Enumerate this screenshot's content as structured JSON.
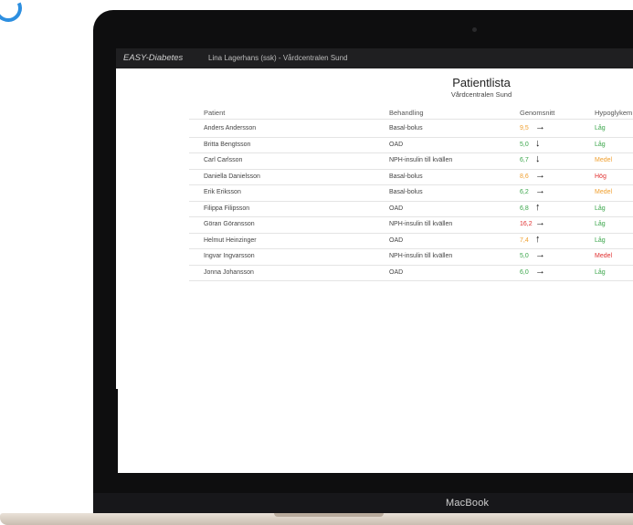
{
  "device": {
    "brand": "MacBook"
  },
  "app": {
    "title": "EASY-Diabetes",
    "user_info": "Lina Lagerhans (ssk) - Vårdcentralen Sund"
  },
  "page": {
    "title": "Patientlista",
    "subtitle": "Vårdcentralen Sund"
  },
  "table": {
    "headers": {
      "patient": "Patient",
      "treatment": "Behandling",
      "average": "Genomsnitt",
      "hypo": "Hypoglykem"
    },
    "rows": [
      {
        "patient": "Anders Andersson",
        "treatment": "Basal-bolus",
        "average": "9,5",
        "average_color": "#f0a030",
        "trend": "→",
        "hypo": "Låg",
        "hypo_color": "#3aa54a"
      },
      {
        "patient": "Britta Bengtsson",
        "treatment": "OAD",
        "average": "5,0",
        "average_color": "#3aa54a",
        "trend": "↓",
        "hypo": "Låg",
        "hypo_color": "#3aa54a"
      },
      {
        "patient": "Carl Carlsson",
        "treatment": "NPH-insulin till kvällen",
        "average": "6,7",
        "average_color": "#3aa54a",
        "trend": "↓",
        "hypo": "Medel",
        "hypo_color": "#f0a030"
      },
      {
        "patient": "Daniella Danielsson",
        "treatment": "Basal-bolus",
        "average": "8,6",
        "average_color": "#f0a030",
        "trend": "→",
        "hypo": "Hög",
        "hypo_color": "#e03030"
      },
      {
        "patient": "Erik Eriksson",
        "treatment": "Basal-bolus",
        "average": "6,2",
        "average_color": "#3aa54a",
        "trend": "→",
        "hypo": "Medel",
        "hypo_color": "#f0a030"
      },
      {
        "patient": "Filippa Filipsson",
        "treatment": "OAD",
        "average": "6,8",
        "average_color": "#3aa54a",
        "trend": "↑",
        "hypo": "Låg",
        "hypo_color": "#3aa54a"
      },
      {
        "patient": "Göran Göransson",
        "treatment": "NPH-insulin till kvällen",
        "average": "16,2",
        "average_color": "#e03030",
        "trend": "→",
        "hypo": "Låg",
        "hypo_color": "#3aa54a"
      },
      {
        "patient": "Helmut Heinzinger",
        "treatment": "OAD",
        "average": "7,4",
        "average_color": "#f0a030",
        "trend": "↑",
        "hypo": "Låg",
        "hypo_color": "#3aa54a"
      },
      {
        "patient": "Ingvar Ingvarsson",
        "treatment": "NPH-insulin till kvällen",
        "average": "5,0",
        "average_color": "#3aa54a",
        "trend": "→",
        "hypo": "Medel",
        "hypo_color": "#e03030"
      },
      {
        "patient": "Jonna Johansson",
        "treatment": "OAD",
        "average": "6,0",
        "average_color": "#3aa54a",
        "trend": "→",
        "hypo": "Låg",
        "hypo_color": "#3aa54a"
      }
    ]
  }
}
